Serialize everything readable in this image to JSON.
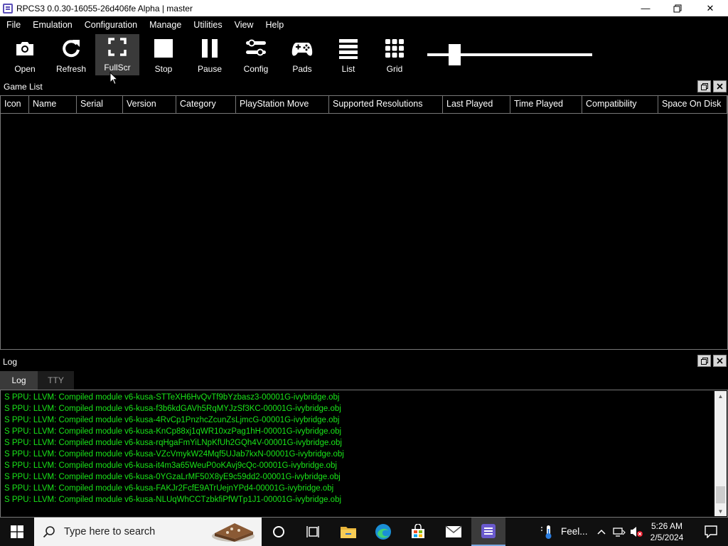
{
  "window": {
    "title": "RPCS3 0.0.30-16055-26d406fe Alpha | master",
    "minimize": "—",
    "maximize": "❐",
    "close": "✕"
  },
  "menu": [
    "File",
    "Emulation",
    "Configuration",
    "Manage",
    "Utilities",
    "View",
    "Help"
  ],
  "toolbar": [
    {
      "label": "Open",
      "icon": "camera-icon"
    },
    {
      "label": "Refresh",
      "icon": "refresh-icon"
    },
    {
      "label": "FullScr",
      "icon": "fullscreen-icon",
      "active": true
    },
    {
      "label": "Stop",
      "icon": "stop-icon"
    },
    {
      "label": "Pause",
      "icon": "pause-icon"
    },
    {
      "label": "Config",
      "icon": "config-icon"
    },
    {
      "label": "Pads",
      "icon": "gamepad-icon"
    },
    {
      "label": "List",
      "icon": "list-icon"
    },
    {
      "label": "Grid",
      "icon": "grid-icon"
    }
  ],
  "zoom_slider": {
    "value": 0.14
  },
  "game_list": {
    "title": "Game List",
    "columns": [
      "Icon",
      "Name",
      "Serial",
      "Version",
      "Category",
      "PlayStation Move",
      "Supported Resolutions",
      "Last Played",
      "Time Played",
      "Compatibility",
      "Space On Disk"
    ],
    "rows": []
  },
  "log": {
    "title": "Log",
    "tabs": [
      "Log",
      "TTY"
    ],
    "active_tab": "Log",
    "lines": [
      "S PPU: LLVM: Compiled module v6-kusa-STTeXH6HvQvTf9bYzbasz3-00001G-ivybridge.obj",
      "S PPU: LLVM: Compiled module v6-kusa-f3b6kdGAVh5RqMYJzSf3KC-00001G-ivybridge.obj",
      "S PPU: LLVM: Compiled module v6-kusa-4RvCp1PnzhcZcunZsLjmcG-00001G-ivybridge.obj",
      "S PPU: LLVM: Compiled module v6-kusa-KnCp88xj1qWR10xzPag1hH-00001G-ivybridge.obj",
      "S PPU: LLVM: Compiled module v6-kusa-rqHgaFmYiLNpKfUh2GQh4V-00001G-ivybridge.obj",
      "S PPU: LLVM: Compiled module v6-kusa-VZcVmykW24Mqf5UJab7kxN-00001G-ivybridge.obj",
      "S PPU: LLVM: Compiled module v6-kusa-it4m3a65WeuP0oKAvj9cQc-00001G-ivybridge.obj",
      "S PPU: LLVM: Compiled module v6-kusa-0YGzaLrMF50X8yE9c59dd2-00001G-ivybridge.obj",
      "S PPU: LLVM: Compiled module v6-kusa-FAKJr2FcfE9ATrUejnYPd4-00001G-ivybridge.obj",
      "S PPU: LLVM: Compiled module v6-kusa-NLUqWhCCTzbkfiPfWTp1J1-00001G-ivybridge.obj"
    ]
  },
  "taskbar": {
    "search_placeholder": "Type here to search",
    "weather": "Feel...",
    "time": "5:26 AM",
    "date": "2/5/2024"
  },
  "colors": {
    "log_text": "#19e419",
    "background": "#000000",
    "taskbar": "#101010"
  }
}
